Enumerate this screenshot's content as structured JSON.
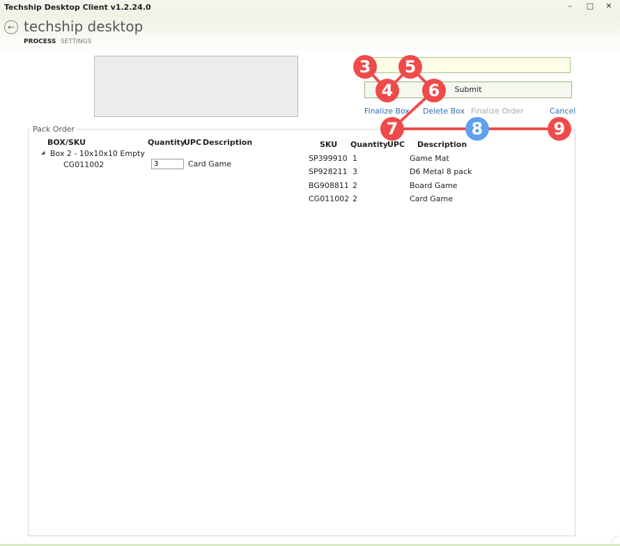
{
  "window": {
    "title": "Techship Desktop Client v1.2.24.0",
    "controls": [
      "–",
      "□",
      "✕"
    ]
  },
  "header": {
    "back_icon": "←",
    "title": "techship desktop",
    "nav": [
      "PROCESS",
      "SETTINGS"
    ]
  },
  "toolbar": {
    "scan_value": "",
    "submit_label": "Submit",
    "links": [
      {
        "label": "Finalize Box",
        "enabled": true
      },
      {
        "label": "Delete Box",
        "enabled": true
      },
      {
        "label": "Finalize Order",
        "enabled": false
      },
      {
        "label": "Cancel",
        "enabled": true
      }
    ]
  },
  "pack_order": {
    "legend": "Pack Order",
    "box_table": {
      "headers": [
        "BOX/SKU",
        "Quantity",
        "UPC",
        "Description"
      ],
      "box_label": "Box 2 - 10x10x10 Empty",
      "rows": [
        {
          "sku": "CG011002",
          "quantity": "3",
          "description": "Card Game"
        }
      ]
    },
    "order_table": {
      "headers": [
        "SKU",
        "Quantity",
        "UPC",
        "Description"
      ],
      "rows": [
        {
          "sku": "SP399910",
          "quantity": "1",
          "description": "Game Mat"
        },
        {
          "sku": "SP928211",
          "quantity": "3",
          "description": "D6 Metal 8 pack"
        },
        {
          "sku": "BG908811",
          "quantity": "2",
          "description": "Board Game"
        },
        {
          "sku": "CG011002",
          "quantity": "2",
          "description": "Card Game"
        }
      ]
    }
  },
  "annotations": {
    "badges": [
      "3",
      "4",
      "5",
      "6",
      "7",
      "8",
      "9"
    ],
    "colors": {
      "red": "#ef4b4b",
      "blue": "#5fa0ef"
    }
  }
}
